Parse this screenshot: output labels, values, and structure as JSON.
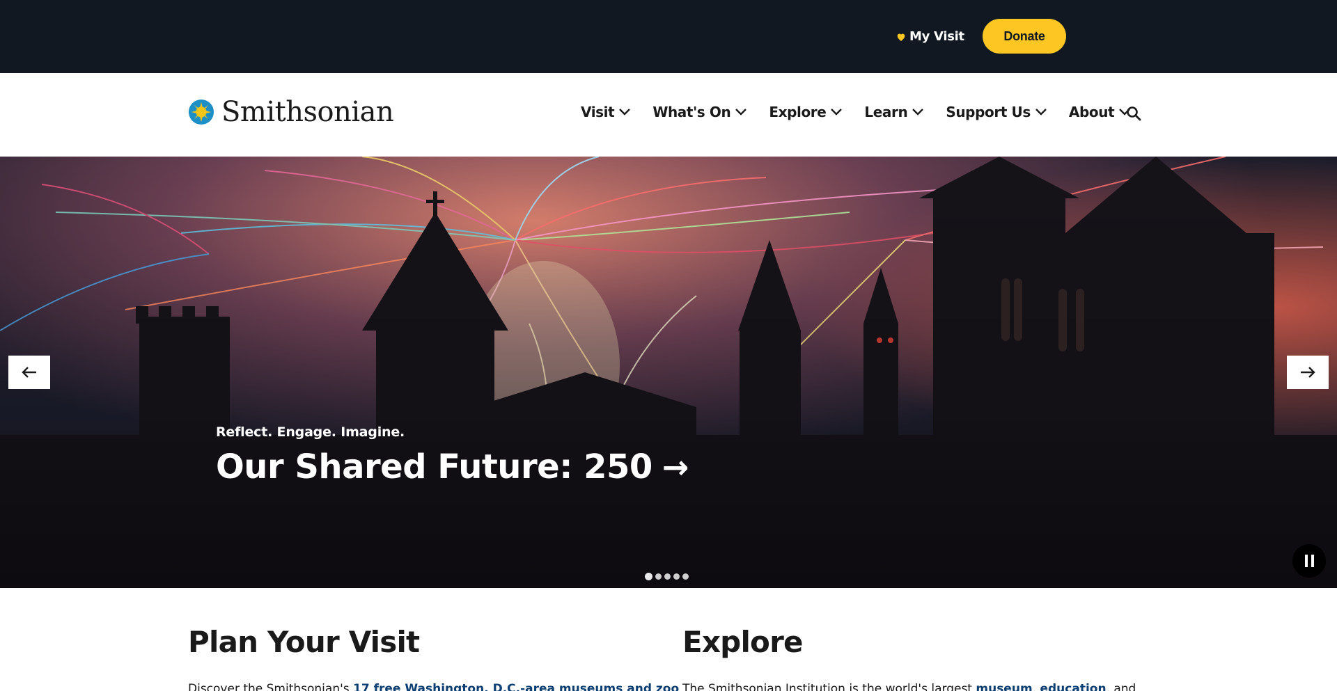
{
  "utility_bar": {
    "my_visit_label": "My Visit",
    "donate_label": "Donate",
    "accent_color": "#fdc623"
  },
  "header": {
    "logo_text": "Smithsonian",
    "nav": [
      {
        "label": "Visit"
      },
      {
        "label": "What's On"
      },
      {
        "label": "Explore"
      },
      {
        "label": "Learn"
      },
      {
        "label": "Support Us"
      },
      {
        "label": "About"
      }
    ],
    "search_icon": "search-icon"
  },
  "hero": {
    "tagline": "Reflect. Engage. Imagine.",
    "title": "Our Shared Future: 250",
    "title_arrow": "→",
    "slides_total": 5,
    "active_slide": 1
  },
  "sections": {
    "plan": {
      "title": "Plan Your Visit",
      "text_prefix": "Discover the Smithsonian's ",
      "link_1": "17 free Washington, D.C.-area museums and zoo"
    },
    "explore": {
      "title": "Explore",
      "text_prefix": "The Smithsonian Institution is the world's largest ",
      "link_1": "museum",
      "separator": ", ",
      "link_2": "education",
      "text_suffix": ", and"
    }
  }
}
